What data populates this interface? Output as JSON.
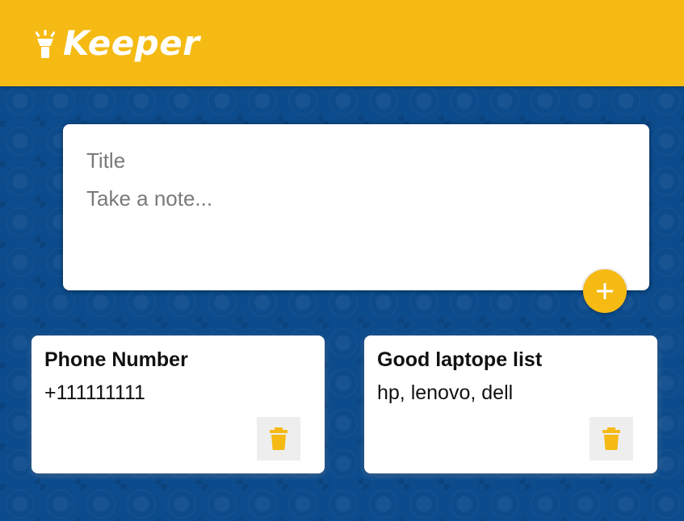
{
  "header": {
    "app_name": "Keeper",
    "logo_icon": "highlight-lightbulb-icon",
    "bg_color": "#f5ba13"
  },
  "create_note": {
    "title_placeholder": "Title",
    "content_placeholder": "Take a note...",
    "add_icon": "plus-icon"
  },
  "notes": [
    {
      "title": "Phone Number",
      "content": "+111111111",
      "delete_icon": "trash-icon"
    },
    {
      "title": "Good laptope list",
      "content": "hp, lenovo, dell",
      "delete_icon": "trash-icon"
    }
  ],
  "colors": {
    "accent": "#f5ba13",
    "background": "#0c4b8c",
    "card": "#ffffff"
  }
}
